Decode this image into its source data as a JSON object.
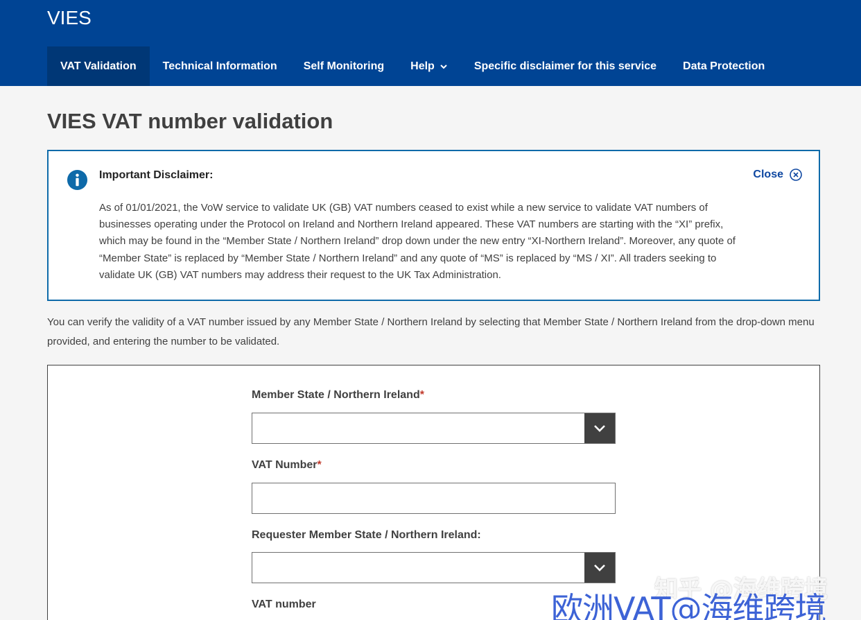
{
  "header": {
    "site_title": "VIES",
    "nav": [
      {
        "label": "VAT Validation",
        "active": true
      },
      {
        "label": "Technical Information"
      },
      {
        "label": "Self Monitoring"
      },
      {
        "label": "Help",
        "icon": "chevron-down-icon"
      },
      {
        "label": "Specific disclaimer for this service"
      },
      {
        "label": "Data Protection"
      }
    ]
  },
  "page": {
    "title": "VIES VAT number validation"
  },
  "disclaimer": {
    "heading": "Important Disclaimer:",
    "close_label": "Close",
    "text": "As of 01/01/2021, the VoW service to validate UK (GB) VAT numbers ceased to exist while a new service to validate VAT numbers of businesses operating under the Protocol on Ireland and Northern Ireland appeared. These VAT numbers are starting with the “XI” prefix, which may be found in the “Member State / Northern Ireland” drop down under the new entry “XI-Northern Ireland”. Moreover, any quote of “Member State” is replaced by “Member State / Northern Ireland” and any quote of “MS” is replaced by “MS / XI”. All traders seeking to validate UK (GB) VAT numbers may address their request to the UK Tax Administration."
  },
  "intro": "You can verify the validity of a VAT number issued by any Member State / Northern Ireland by selecting that Member State / Northern Ireland from the drop-down menu provided, and entering the number to be validated.",
  "form": {
    "member_state_label": "Member State / Northern Ireland",
    "member_state_value": "",
    "vat_number_label": "VAT Number",
    "vat_number_value": "",
    "requester_label": "Requester Member State / Northern Ireland:",
    "requester_value": "",
    "requester_vat_label": "VAT number",
    "required_mark": "*"
  },
  "watermark": {
    "line1": "知乎 @海维跨境",
    "line2": "欧洲VAT@海维跨境"
  },
  "colors": {
    "header_bg": "#004494",
    "nav_active_bg": "#003776",
    "info_blue": "#0e6aa9",
    "select_button": "#404040",
    "required_red": "#c0392b"
  }
}
